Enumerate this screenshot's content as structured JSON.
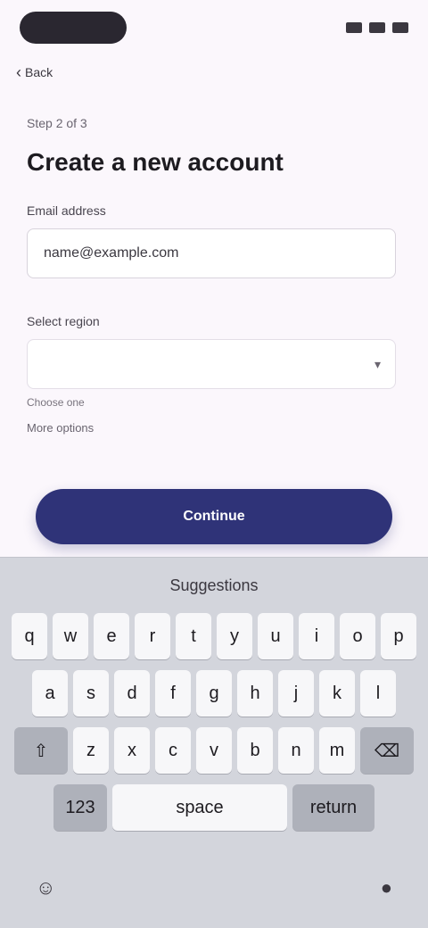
{
  "status": {
    "time": ""
  },
  "nav": {
    "back_label": "Back"
  },
  "form": {
    "step": "Step 2 of 3",
    "title": "Create a new account",
    "email_label": "Email address",
    "email_value": "name@example.com",
    "region_label": "Select region",
    "region_placeholder": "",
    "helper": "Choose one",
    "link": "More options"
  },
  "actions": {
    "continue_label": "Continue"
  },
  "keyboard": {
    "suggestion": "Suggestions",
    "row1": [
      "q",
      "w",
      "e",
      "r",
      "t",
      "y",
      "u",
      "i",
      "o",
      "p"
    ],
    "row2": [
      "a",
      "s",
      "d",
      "f",
      "g",
      "h",
      "j",
      "k",
      "l"
    ],
    "row3": [
      "z",
      "x",
      "c",
      "v",
      "b",
      "n",
      "m"
    ],
    "space_label": "space",
    "return_label": "return",
    "num_label": "123",
    "emoji_icon": "emoji-icon",
    "mic_icon": "mic-icon"
  }
}
